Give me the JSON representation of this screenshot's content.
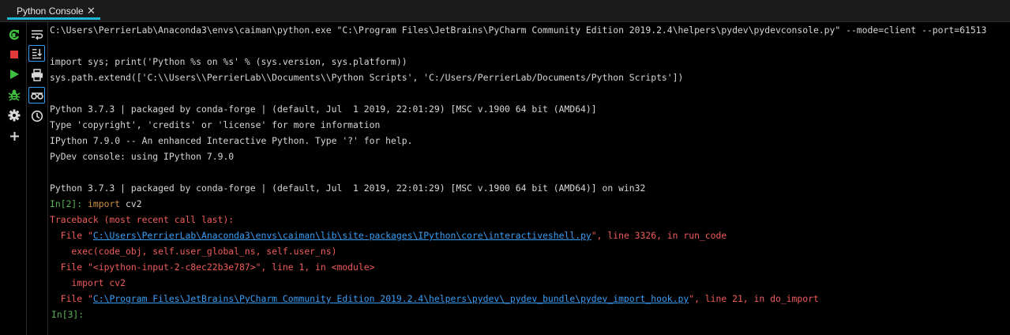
{
  "tab": {
    "title": "Python Console",
    "close_glyph": "✕"
  },
  "toolbar_left": [
    {
      "name": "rerun-icon",
      "color": "#3fbf3f"
    },
    {
      "name": "stop-icon",
      "color": "#e03a3a"
    },
    {
      "name": "run-icon",
      "color": "#3fbf3f"
    },
    {
      "name": "debug-icon",
      "color": "#3fbf3f"
    },
    {
      "name": "gear-icon",
      "color": "#d9d9d9"
    },
    {
      "name": "plus-icon",
      "color": "#d9d9d9"
    }
  ],
  "toolbar_right": [
    {
      "name": "soft-wrap-icon"
    },
    {
      "name": "scroll-to-end-icon"
    },
    {
      "name": "print-icon"
    },
    {
      "name": "variables-view-icon"
    },
    {
      "name": "history-icon"
    }
  ],
  "console": {
    "cmd_line": "C:\\Users\\PerrierLab\\Anaconda3\\envs\\caiman\\python.exe \"C:\\Program Files\\JetBrains\\PyCharm Community Edition 2019.2.4\\helpers\\pydev\\pydevconsole.py\" --mode=client --port=61513",
    "import_sys": "import sys; print('Python %s on %s' % (sys.version, sys.platform))",
    "path_extend": "sys.path.extend(['C:\\\\Users\\\\PerrierLab\\\\Documents\\\\Python Scripts', 'C:/Users/PerrierLab/Documents/Python Scripts'])",
    "python_version_1": "Python 3.7.3 | packaged by conda-forge | (default, Jul  1 2019, 22:01:29) [MSC v.1900 64 bit (AMD64)]",
    "type_info": "Type 'copyright', 'credits' or 'license' for more information",
    "ipython_info": "IPython 7.9.0 -- An enhanced Interactive Python. Type '?' for help.",
    "pydev_info": "PyDev console: using IPython 7.9.0",
    "python_version_2": "Python 3.7.3 | packaged by conda-forge | (default, Jul  1 2019, 22:01:29) [MSC v.1900 64 bit (AMD64)] on win32",
    "prompt_2": "In[2]: ",
    "import_kw": "import",
    "import_rest": " cv2",
    "traceback_header": "Traceback (most recent call last):",
    "tb1_prefix": "  File \"",
    "tb1_link": "C:\\Users\\PerrierLab\\Anaconda3\\envs\\caiman\\lib\\site-packages\\IPython\\core\\interactiveshell.py",
    "tb1_suffix": "\", line 3326, in run_code",
    "tb1_code": "    exec(code_obj, self.user_global_ns, self.user_ns)",
    "tb2_line": "  File \"<ipython-input-2-c8ec22b3e787>\", line 1, in <module>",
    "tb2_code": "    import cv2",
    "tb3_prefix": "  File \"",
    "tb3_link": "C:\\Program Files\\JetBrains\\PyCharm Community Edition 2019.2.4\\helpers\\pydev\\_pydev_bundle\\pydev_import_hook.py",
    "tb3_suffix": "\", line 21, in do_import",
    "prompt_3": "In[3]:"
  }
}
